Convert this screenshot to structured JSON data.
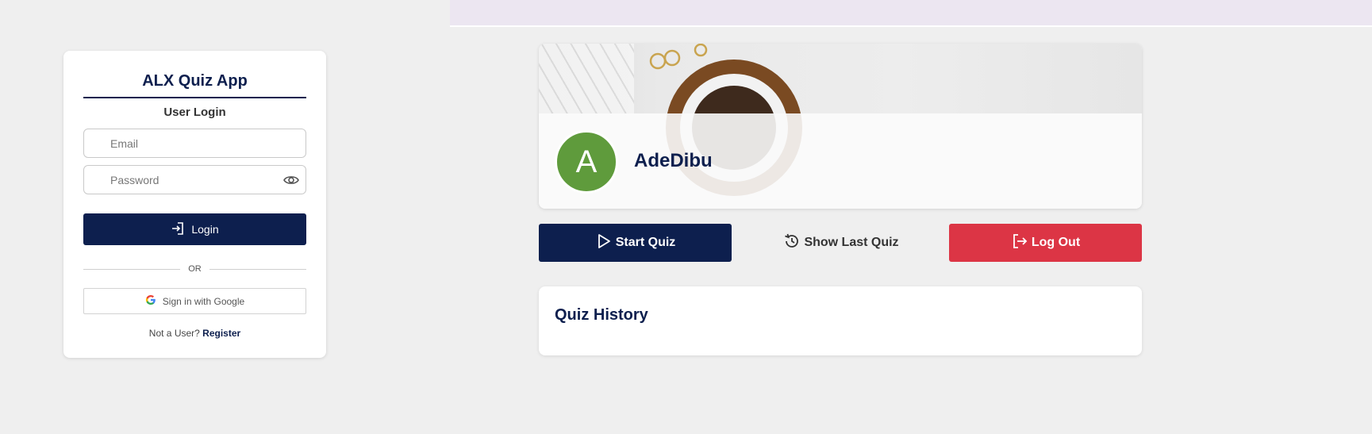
{
  "login": {
    "app_title": "ALX Quiz App",
    "subtitle": "User Login",
    "email_placeholder": "Email",
    "password_placeholder": "Password",
    "login_label": "Login",
    "or_text": "OR",
    "google_label": "Sign in with Google",
    "register_prompt": "Not a User?",
    "register_link": "Register"
  },
  "profile": {
    "avatar_letter": "A",
    "username": "AdeDibu"
  },
  "actions": {
    "start_label": "Start Quiz",
    "last_label": "Show Last Quiz",
    "logout_label": "Log Out"
  },
  "history": {
    "title": "Quiz History"
  },
  "colors": {
    "primary": "#0d1f4e",
    "danger": "#dc3545",
    "avatar": "#5f9b3c",
    "topbar": "#ece6f1",
    "background": "#efefef"
  },
  "icons": {
    "login": "login-icon",
    "eye": "eye-icon",
    "google": "google-icon",
    "play": "play-icon",
    "history": "history-icon",
    "logout": "logout-icon"
  }
}
